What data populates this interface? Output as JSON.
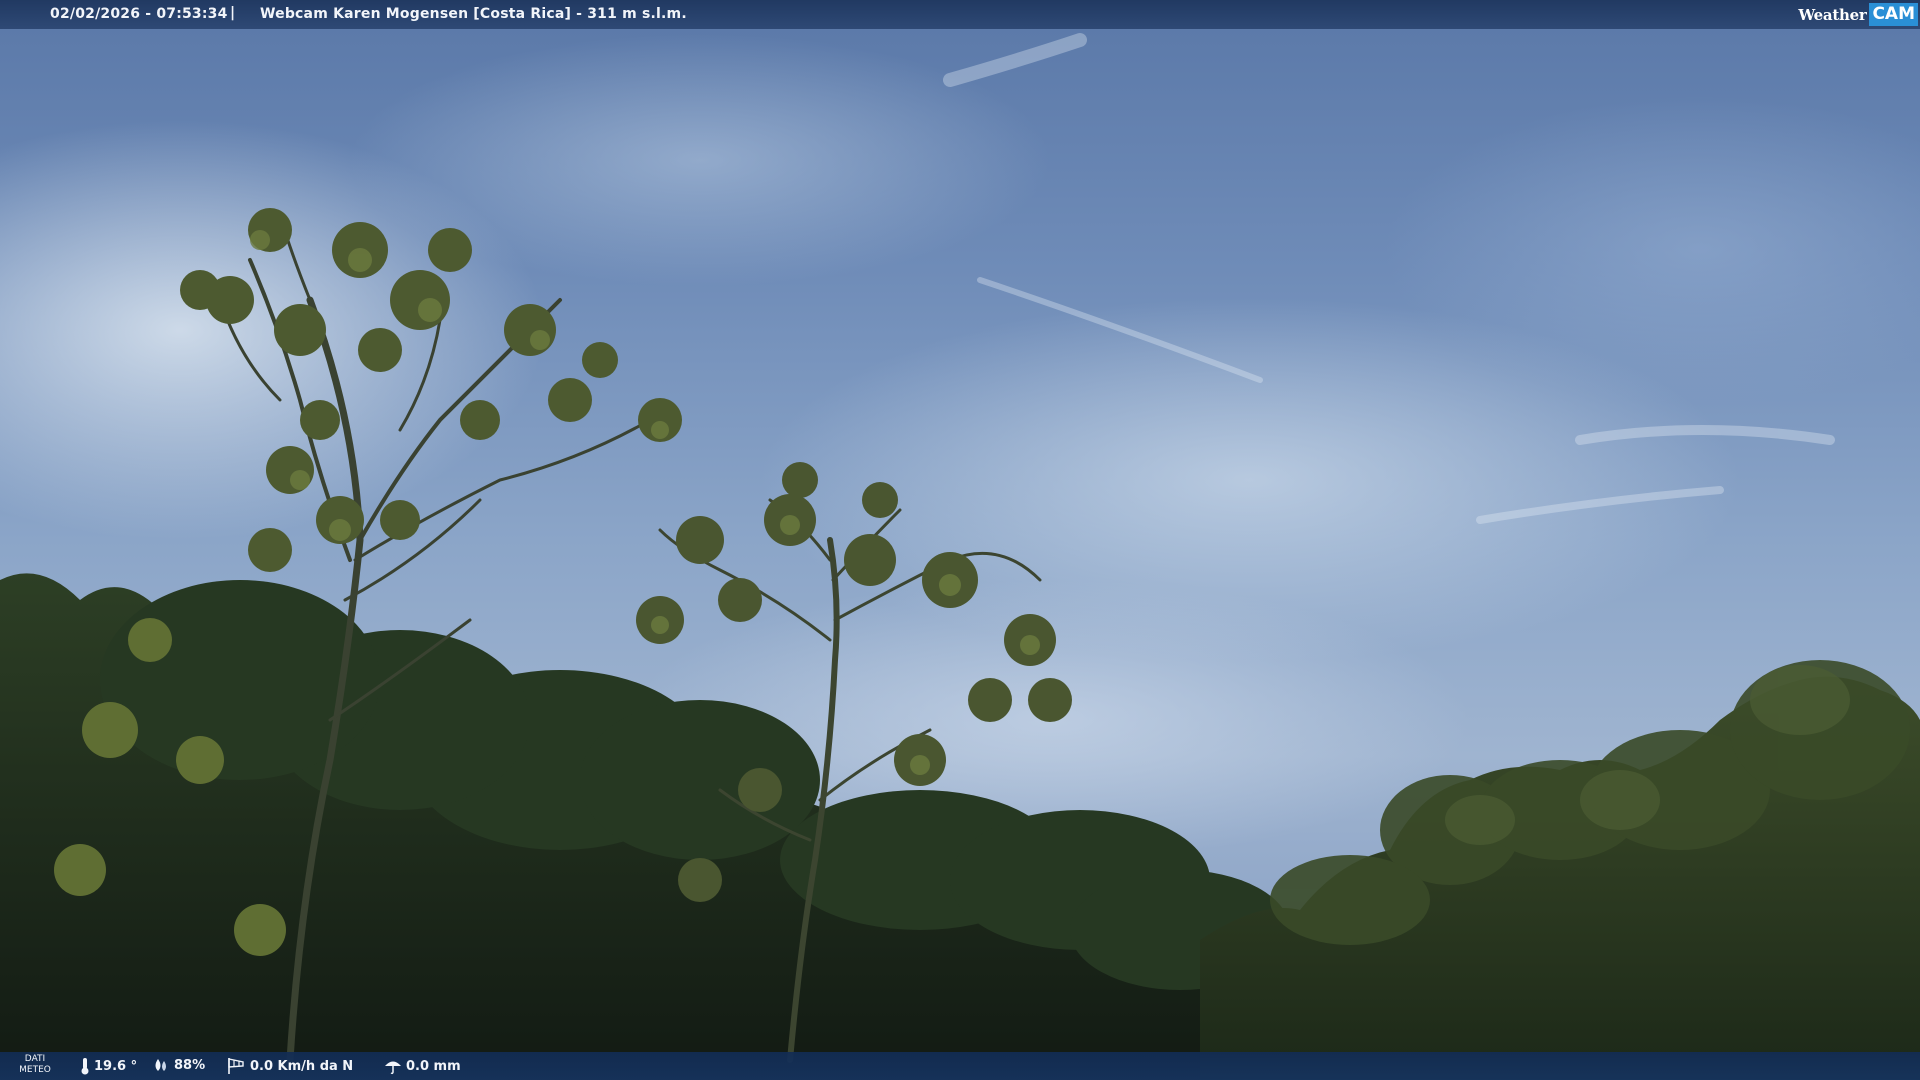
{
  "header": {
    "timestamp": "02/02/2026 - 07:53:34",
    "separator": "|",
    "title": "Webcam Karen Mogensen [Costa Rica]  - 311 m s.l.m."
  },
  "logo": {
    "word1": "Weather",
    "word2": "CAM",
    "icon": "globe-dot-icon"
  },
  "weather": {
    "label_line1": "DATI",
    "label_line2": "METEO",
    "temperature": "19.6 °",
    "humidity": "88%",
    "wind": "0.0 Km/h da N",
    "rain": "0.0 mm",
    "icons": {
      "temperature": "thermometer-icon",
      "humidity": "humidity-drops-icon",
      "wind": "wind-windsock-icon",
      "rain": "rain-umbrella-icon"
    }
  }
}
